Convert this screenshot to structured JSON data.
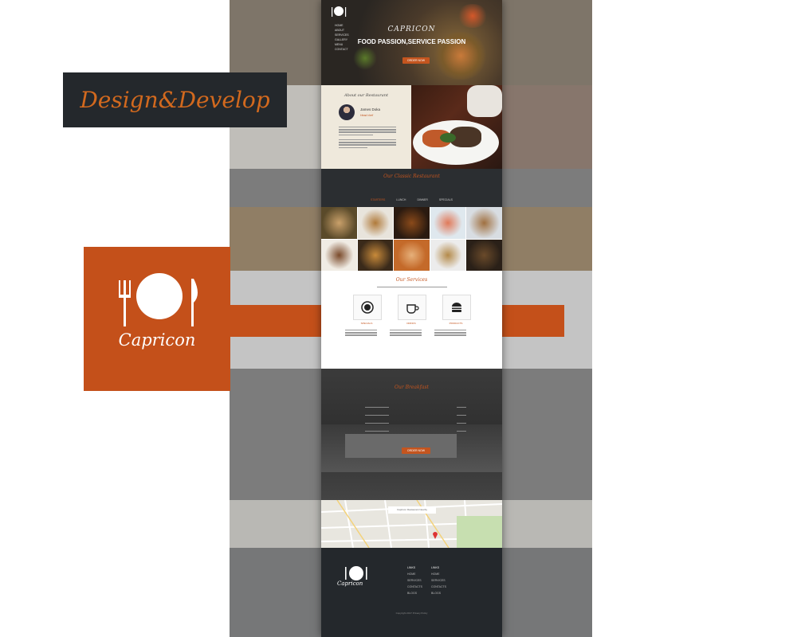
{
  "brand": {
    "name": "CAPRICON",
    "tagline": "FOOD PASSION,SERVICE PASSION",
    "logo_text": "Capricon",
    "accent_color": "#c4501a",
    "dark_color": "#24282c"
  },
  "overlay": {
    "design_label": "Design&Develop"
  },
  "hero": {
    "nav_items": [
      "HOME",
      "ABOUT",
      "SERVICES",
      "GALLERY",
      "MENU",
      "CONTACT"
    ],
    "cta_label": "ORDER NOW"
  },
  "about": {
    "title": "About our Restaurant",
    "chef_name": "James Doka",
    "chef_role": "Head chef"
  },
  "menu": {
    "title": "Our Classic Restaurant",
    "tabs": [
      "STARTERS",
      "LUNCH",
      "DINNER",
      "SPECIALS"
    ]
  },
  "services": {
    "title": "Our Services",
    "items": [
      {
        "label": "SPECIALS",
        "icon": "plate-icon"
      },
      {
        "label": "DRINKS",
        "icon": "coffee-cup-icon"
      },
      {
        "label": "PRODUCTS",
        "icon": "burger-icon"
      }
    ]
  },
  "breakfast": {
    "title": "Our Breakfast",
    "cta_label": "ORDER NOW"
  },
  "map": {
    "search_text": "Capricon Restaurant Nearby"
  },
  "footer": {
    "columns": [
      {
        "heading": "LINKS",
        "items": [
          "HOME",
          "SERVICES",
          "CONTACTS",
          "BLOGS"
        ]
      },
      {
        "heading": "LINKS",
        "items": [
          "HOME",
          "SERVICES",
          "CONTACTS",
          "BLOGS"
        ]
      }
    ],
    "copyright": "Copyright 2017 Privacy Policy"
  }
}
